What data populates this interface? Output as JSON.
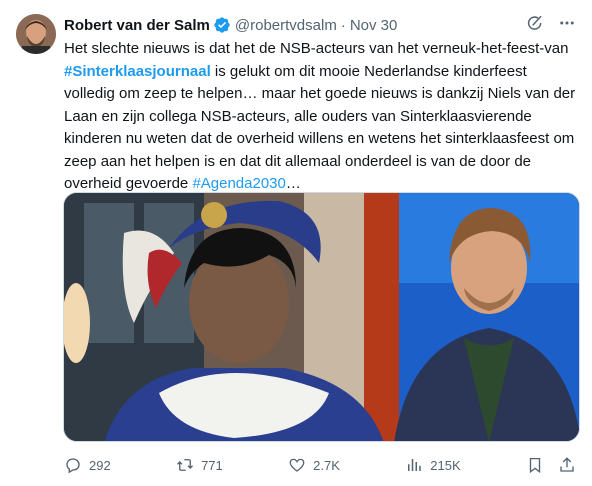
{
  "author": {
    "name": "Robert van der Salm",
    "handle": "@robertvdsalm",
    "separator": "·",
    "date": "Nov 30"
  },
  "tweet": {
    "text_1": "Het slechte nieuws is dat het de NSB-acteurs van het verneuk-het-feest-van ",
    "hashtag_1": "#Sinterklaasjournaal",
    "text_2": " is gelukt om dit mooie Nederlandse kinderfeest volledig om zeep te helpen… maar het goede nieuws is dankzij Niels van der Laan en zijn collega NSB-acteurs, alle ouders van Sinterklaasvierende kinderen nu weten dat de overheid willens en wetens het sinterklaasfeest om zeep aan het helpen is en dat dit allemaal onderdeel is van de door de overheid gevoerde ",
    "hashtag_2": "#Agenda2030",
    "text_3": "…"
  },
  "stats": {
    "replies": "292",
    "reposts": "771",
    "likes": "2.7K",
    "views": "215K"
  },
  "colors": {
    "text": "#0f1419",
    "secondary": "#536471",
    "accent": "#1d9bf0"
  },
  "icons": [
    "verified-badge-icon",
    "grok-icon",
    "more-icon",
    "reply-icon",
    "repost-icon",
    "like-icon",
    "views-icon",
    "bookmark-icon",
    "share-icon"
  ]
}
